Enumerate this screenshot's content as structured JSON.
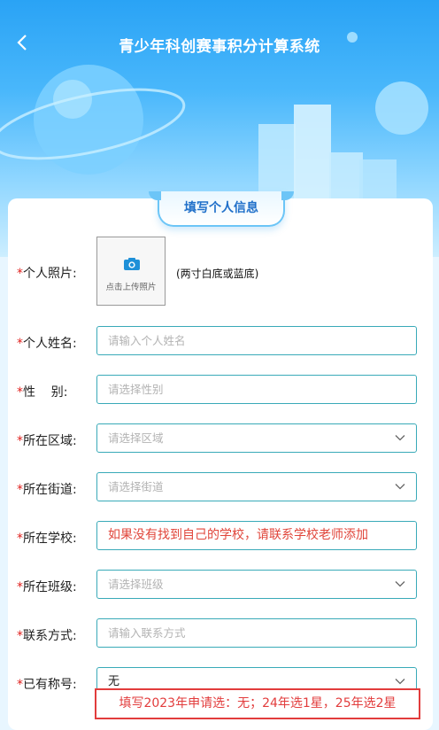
{
  "header": {
    "back_icon": "chevron-left-icon",
    "title": "青少年科创赛事积分计算系统"
  },
  "section_tab": "填写个人信息",
  "photo": {
    "label": "个人照片:",
    "upload_text": "点击上传照片",
    "hint": "(两寸白底或蓝底)",
    "icon": "camera-icon"
  },
  "fields": {
    "name": {
      "label": "个人姓名:",
      "placeholder": "请输入个人姓名"
    },
    "gender": {
      "label": "性    别:",
      "placeholder": "请选择性别"
    },
    "region": {
      "label": "所在区域:",
      "placeholder": "请选择区域"
    },
    "street": {
      "label": "所在街道:",
      "placeholder": "请选择街道"
    },
    "school": {
      "label": "所在学校:",
      "value": "如果没有找到自己的学校，请联系学校老师添加"
    },
    "class": {
      "label": "所在班级:",
      "placeholder": "请选择班级"
    },
    "contact": {
      "label": "联系方式:",
      "placeholder": "请输入联系方式"
    },
    "title": {
      "label": "已有称号:",
      "value": "无"
    }
  },
  "required_mark": "*",
  "note": "填写2023年申请选：无；24年选1星，25年选2星",
  "colors": {
    "accent": "#39aab8",
    "required": "#e0201d",
    "header": "#2aa3f5"
  }
}
